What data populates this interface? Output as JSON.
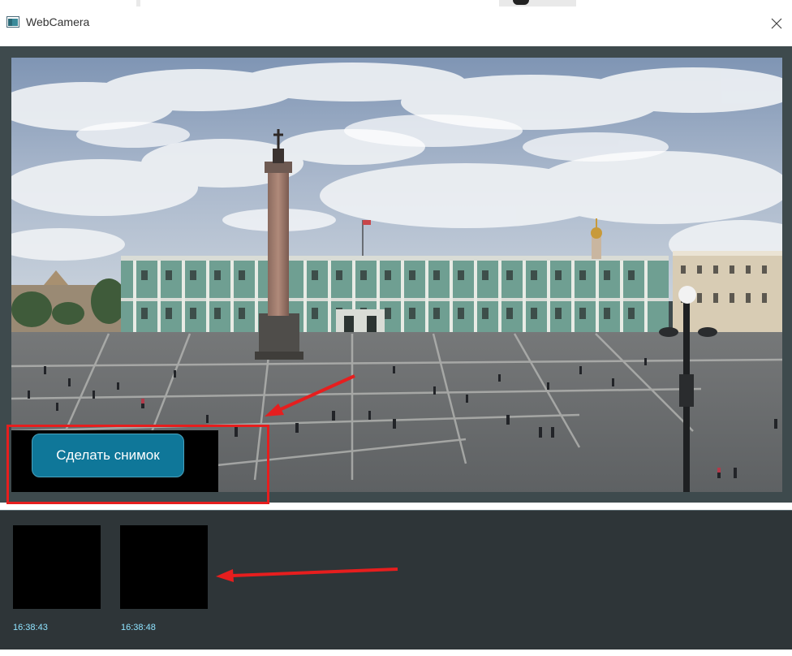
{
  "window": {
    "title": "WebCamera",
    "close_glyph": "✕"
  },
  "camera": {
    "snapshot_button_label": "Сделать снимок",
    "scene": "Palace Square with Alexander Column and Winter Palace"
  },
  "gallery": {
    "snapshots": [
      {
        "time": "16:38:43"
      },
      {
        "time": "16:38:48"
      }
    ]
  },
  "colors": {
    "button": "#0f7799",
    "frame": "#3e4a4d",
    "gallery_bg": "#2e3538",
    "time_text": "#8fe3ff",
    "annotation": "#e61e1e"
  }
}
